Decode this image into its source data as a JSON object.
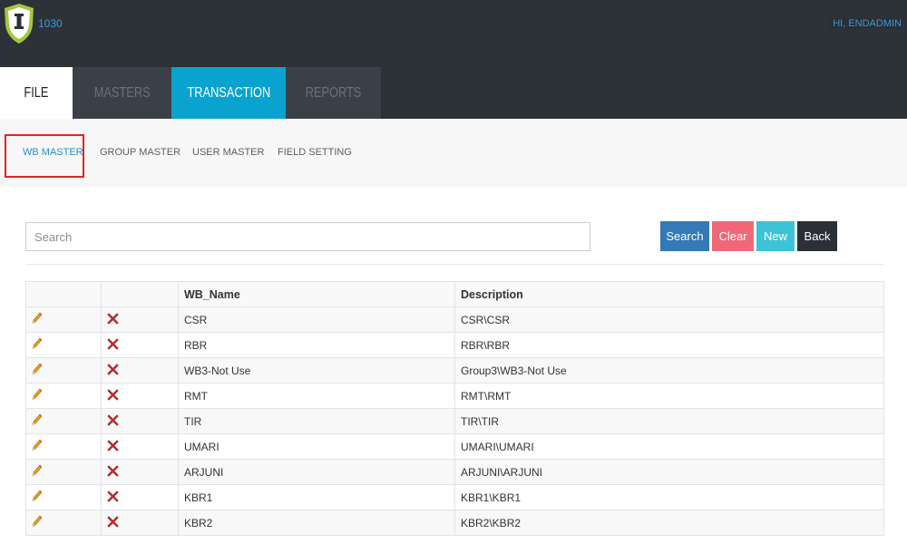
{
  "header": {
    "app_code": "1030",
    "user_greeting": "HI, ENDADMIN"
  },
  "main_tabs": [
    {
      "label": "FILE",
      "state": "current"
    },
    {
      "label": "MASTERS",
      "state": "inactive"
    },
    {
      "label": "TRANSACTION",
      "state": "active"
    },
    {
      "label": "REPORTS",
      "state": "inactive"
    }
  ],
  "sub_nav": [
    {
      "label": "WB MASTER",
      "active": true
    },
    {
      "label": "GROUP MASTER"
    },
    {
      "label": "USER MASTER"
    },
    {
      "label": "FIELD SETTING"
    }
  ],
  "search": {
    "placeholder": "Search",
    "value": ""
  },
  "buttons": {
    "search": "Search",
    "clear": "Clear",
    "new": "New",
    "back": "Back"
  },
  "table": {
    "columns": [
      "",
      "",
      "WB_Name",
      "Description"
    ],
    "rows": [
      {
        "wb_name": "CSR",
        "description": "CSR\\CSR"
      },
      {
        "wb_name": "RBR",
        "description": "RBR\\RBR"
      },
      {
        "wb_name": "WB3-Not Use",
        "description": "Group3\\WB3-Not Use"
      },
      {
        "wb_name": "RMT",
        "description": "RMT\\RMT"
      },
      {
        "wb_name": "TIR",
        "description": "TIR\\TIR"
      },
      {
        "wb_name": "UMARI",
        "description": "UMARI\\UMARI"
      },
      {
        "wb_name": "ARJUNI",
        "description": "ARJUNI\\ARJUNI"
      },
      {
        "wb_name": "KBR1",
        "description": "KBR1\\KBR1"
      },
      {
        "wb_name": "KBR2",
        "description": "KBR2\\KBR2"
      }
    ]
  },
  "icons": {
    "edit": "pencil-icon",
    "delete": "delete-x-icon",
    "logo": "shield-logo-icon"
  },
  "colors": {
    "header_bg": "#2d3138",
    "tab_active": "#0aa3cf",
    "search_button": "#337ab7",
    "clear_button": "#f06878",
    "new_button": "#3cc4d6",
    "back_button": "#2b2f36",
    "delete_icon": "#c0282d"
  }
}
